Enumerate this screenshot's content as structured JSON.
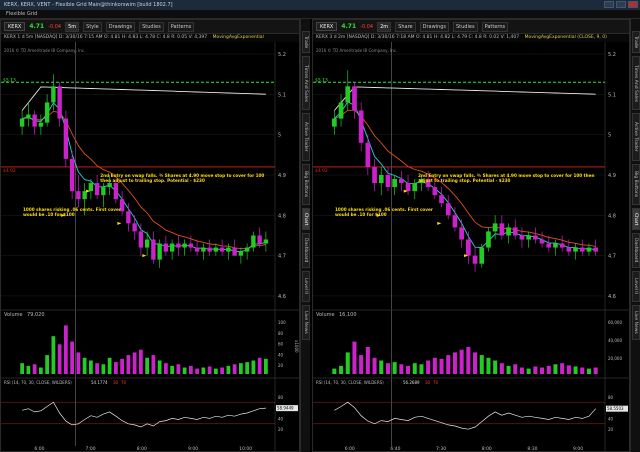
{
  "window": {
    "title": "KERX, KERX, VENT - Flexible Grid Main@thinkorswim [build 1802.7]",
    "grid_title": "Flexible Grid"
  },
  "colors": {
    "up": "#22cc22",
    "down": "#cc22cc",
    "ema_short": "#2ad4d4",
    "ema_long": "#e05020",
    "sma_slow": "#e8e8e8",
    "green_line": "#33ee33",
    "red_line": "#dd2222",
    "annotation": "#ffdd00",
    "grid": "#1e1e1e"
  },
  "charts": [
    {
      "symbol": "KERX",
      "price": "4.71",
      "change": "-0.04",
      "period": "5m",
      "toolbar": [
        "Style",
        "Drawings",
        "Studies",
        "Patterns"
      ],
      "info": "KERX 1 d 5m [NASDAQ]  D: 3/30/16 7:15 AM  O: 4.81  H: 4.83  L: 4.78  C: 4.8  R: 0.05  V: 4,397",
      "study_label": "MovingAvgExponential",
      "copyright": "2016 © TD Ameritrade IB Company, Inc.",
      "yticks": [
        "5.2",
        "5.1",
        "5",
        "4.9",
        "4.8",
        "4.7",
        "4.6"
      ],
      "xticks": [
        "6:00",
        "7:00",
        "8:00",
        "9:00",
        "10:00"
      ],
      "green_label": "$5.13",
      "red_label": "$4.92",
      "annotation_a": "2nd Entry on vwap falls. ¾ Shares at 4.90 move stop to cover for 100 then adjust to trailing stop. Potential - $230",
      "annotation_b": "1000 shares risking .06 cents. First cover would be .10 for $100",
      "volume_label": "Volume",
      "volume_value": "79,020",
      "volume_yticks": [
        "100",
        "80",
        "60",
        "40",
        "20"
      ],
      "volume_right": "x1000",
      "rsi_label": "RSI (14, 70, 30, CLOSE, WILDERS)",
      "rsi_value": "54.1774",
      "rsi_levels": [
        "30",
        "70"
      ],
      "rsi_yticks": [
        "80",
        "60",
        "40",
        "20"
      ],
      "rsi_current": "58.9449",
      "bars": [
        [
          5.02,
          5.06,
          5.0,
          5.04
        ],
        [
          5.04,
          5.08,
          5.02,
          5.05
        ],
        [
          5.05,
          5.06,
          5.0,
          5.02
        ],
        [
          5.02,
          5.05,
          5.0,
          5.03
        ],
        [
          5.03,
          5.1,
          5.02,
          5.08
        ],
        [
          5.08,
          5.15,
          5.06,
          5.12
        ],
        [
          5.12,
          5.13,
          5.02,
          5.04
        ],
        [
          5.04,
          5.06,
          4.92,
          4.94
        ],
        [
          4.94,
          4.96,
          4.84,
          4.86
        ],
        [
          4.86,
          4.9,
          4.82,
          4.84
        ],
        [
          4.84,
          4.88,
          4.8,
          4.86
        ],
        [
          4.86,
          4.89,
          4.84,
          4.88
        ],
        [
          4.88,
          4.9,
          4.84,
          4.85
        ],
        [
          4.85,
          4.88,
          4.82,
          4.87
        ],
        [
          4.87,
          4.9,
          4.85,
          4.88
        ],
        [
          4.88,
          4.89,
          4.83,
          4.84
        ],
        [
          4.84,
          4.86,
          4.8,
          4.81
        ],
        [
          4.81,
          4.83,
          4.76,
          4.78
        ],
        [
          4.78,
          4.8,
          4.74,
          4.76
        ],
        [
          4.76,
          4.78,
          4.7,
          4.72
        ],
        [
          4.72,
          4.76,
          4.7,
          4.74
        ],
        [
          4.74,
          4.76,
          4.68,
          4.69
        ],
        [
          4.69,
          4.74,
          4.67,
          4.73
        ],
        [
          4.73,
          4.75,
          4.7,
          4.71
        ],
        [
          4.71,
          4.74,
          4.69,
          4.73
        ],
        [
          4.73,
          4.75,
          4.7,
          4.72
        ],
        [
          4.72,
          4.74,
          4.7,
          4.73
        ],
        [
          4.73,
          4.75,
          4.71,
          4.72
        ],
        [
          4.72,
          4.74,
          4.7,
          4.71
        ],
        [
          4.71,
          4.73,
          4.69,
          4.72
        ],
        [
          4.72,
          4.74,
          4.7,
          4.71
        ],
        [
          4.71,
          4.73,
          4.7,
          4.72
        ],
        [
          4.72,
          4.74,
          4.7,
          4.71
        ],
        [
          4.71,
          4.73,
          4.69,
          4.72
        ],
        [
          4.72,
          4.74,
          4.7,
          4.7
        ],
        [
          4.7,
          4.72,
          4.68,
          4.71
        ],
        [
          4.71,
          4.73,
          4.69,
          4.72
        ],
        [
          4.72,
          4.76,
          4.71,
          4.75
        ],
        [
          4.75,
          4.77,
          4.72,
          4.73
        ],
        [
          4.73,
          4.76,
          4.71,
          4.74
        ]
      ],
      "volumes": [
        20,
        15,
        18,
        12,
        35,
        70,
        55,
        90,
        60,
        40,
        30,
        25,
        20,
        18,
        30,
        22,
        28,
        35,
        40,
        45,
        30,
        35,
        25,
        20,
        15,
        18,
        12,
        15,
        10,
        12,
        14,
        10,
        12,
        15,
        18,
        20,
        22,
        25,
        30,
        28
      ],
      "rsi": [
        55,
        58,
        52,
        54,
        62,
        70,
        50,
        35,
        28,
        30,
        38,
        45,
        42,
        48,
        52,
        44,
        36,
        30,
        28,
        24,
        30,
        26,
        34,
        36,
        40,
        38,
        42,
        40,
        38,
        42,
        40,
        44,
        42,
        46,
        44,
        48,
        50,
        54,
        58,
        59
      ]
    },
    {
      "symbol": "KERX",
      "price": "4.71",
      "change": "-0.04",
      "period": "2m",
      "toolbar": [
        "Share",
        "Drawings",
        "Studies",
        "Patterns"
      ],
      "info": "KERX 3 d 2m [NASDAQ]  D: 3/30/16 7:18 AM  O: 4.81  H: 4.82  L: 4.79  C: 4.8  R: 0.02  V: 1,407",
      "study_label": "MovingAvgExponential (CLOSE, 9, 0)",
      "copyright": "2016 © TD Ameritrade IB Company, Inc.",
      "yticks": [
        "5.2",
        "5.1",
        "5",
        "4.9",
        "4.8",
        "4.7",
        "4.6"
      ],
      "xticks": [
        "6:00",
        "6:40",
        "7:30",
        "8:00",
        "8:30",
        "9:00"
      ],
      "green_label": "$5.13",
      "red_label": "$4.92",
      "annotation_a": "2nd Entry on vwap falls. ¾ Shares at 4.90 move stop to cover for 100 then adjust to trailing stop. Potential - $230",
      "annotation_b": "1000 shares risking .06 cents. First cover would be .10 for $100",
      "volume_label": "Volume",
      "volume_value": "16,100",
      "volume_yticks": [
        "60,000",
        "40,000",
        "20,000"
      ],
      "volume_right": "",
      "rsi_label": "RSI (14, 70, 30, CLOSE, WILDERS)",
      "rsi_value": "56.2689",
      "rsi_levels": [
        "30",
        "70"
      ],
      "rsi_yticks": [
        "80",
        "60",
        "40",
        "20"
      ],
      "rsi_current": "58.5503",
      "bars": [
        [
          5.02,
          5.06,
          5.0,
          5.04
        ],
        [
          5.04,
          5.1,
          5.02,
          5.08
        ],
        [
          5.08,
          5.16,
          5.06,
          5.12
        ],
        [
          5.12,
          5.13,
          5.04,
          5.06
        ],
        [
          5.06,
          5.08,
          4.96,
          4.98
        ],
        [
          4.98,
          5.0,
          4.9,
          4.92
        ],
        [
          4.92,
          4.94,
          4.86,
          4.88
        ],
        [
          4.88,
          4.92,
          4.85,
          4.9
        ],
        [
          4.9,
          4.92,
          4.86,
          4.87
        ],
        [
          4.87,
          4.9,
          4.85,
          4.89
        ],
        [
          4.89,
          4.91,
          4.86,
          4.88
        ],
        [
          4.88,
          4.9,
          4.85,
          4.86
        ],
        [
          4.86,
          4.89,
          4.84,
          4.88
        ],
        [
          4.88,
          4.9,
          4.86,
          4.89
        ],
        [
          4.89,
          4.91,
          4.86,
          4.87
        ],
        [
          4.87,
          4.89,
          4.84,
          4.85
        ],
        [
          4.85,
          4.87,
          4.82,
          4.83
        ],
        [
          4.83,
          4.85,
          4.79,
          4.8
        ],
        [
          4.8,
          4.82,
          4.76,
          4.77
        ],
        [
          4.77,
          4.79,
          4.72,
          4.74
        ],
        [
          4.74,
          4.76,
          4.68,
          4.7
        ],
        [
          4.7,
          4.72,
          4.66,
          4.68
        ],
        [
          4.68,
          4.73,
          4.67,
          4.72
        ],
        [
          4.72,
          4.77,
          4.71,
          4.76
        ],
        [
          4.76,
          4.8,
          4.74,
          4.78
        ],
        [
          4.78,
          4.8,
          4.74,
          4.75
        ],
        [
          4.75,
          4.78,
          4.73,
          4.77
        ],
        [
          4.77,
          4.79,
          4.74,
          4.75
        ],
        [
          4.75,
          4.77,
          4.72,
          4.74
        ],
        [
          4.74,
          4.76,
          4.72,
          4.75
        ],
        [
          4.75,
          4.77,
          4.73,
          4.74
        ],
        [
          4.74,
          4.76,
          4.72,
          4.73
        ],
        [
          4.73,
          4.75,
          4.71,
          4.72
        ],
        [
          4.72,
          4.74,
          4.7,
          4.73
        ],
        [
          4.73,
          4.75,
          4.71,
          4.72
        ],
        [
          4.72,
          4.74,
          4.7,
          4.71
        ],
        [
          4.71,
          4.73,
          4.69,
          4.72
        ],
        [
          4.72,
          4.74,
          4.7,
          4.71
        ],
        [
          4.71,
          4.73,
          4.7,
          4.72
        ],
        [
          4.72,
          4.74,
          4.7,
          4.71
        ]
      ],
      "volumes": [
        10,
        15,
        40,
        60,
        35,
        50,
        30,
        25,
        20,
        22,
        18,
        15,
        20,
        18,
        25,
        30,
        28,
        35,
        40,
        45,
        50,
        40,
        35,
        30,
        25,
        20,
        15,
        18,
        12,
        10,
        14,
        12,
        15,
        18,
        20,
        16,
        14,
        12,
        10,
        12
      ],
      "rsi": [
        55,
        62,
        70,
        60,
        45,
        35,
        30,
        36,
        34,
        40,
        38,
        36,
        42,
        44,
        40,
        36,
        32,
        28,
        26,
        22,
        20,
        24,
        34,
        44,
        52,
        46,
        50,
        46,
        42,
        44,
        42,
        40,
        38,
        42,
        40,
        38,
        42,
        40,
        44,
        58
      ]
    }
  ],
  "side_tabs": [
    "Trade",
    "Times And Sales",
    "Active Trader",
    "Big Buttons",
    "Chart",
    "Dashboard",
    "Level II",
    "Live News"
  ]
}
